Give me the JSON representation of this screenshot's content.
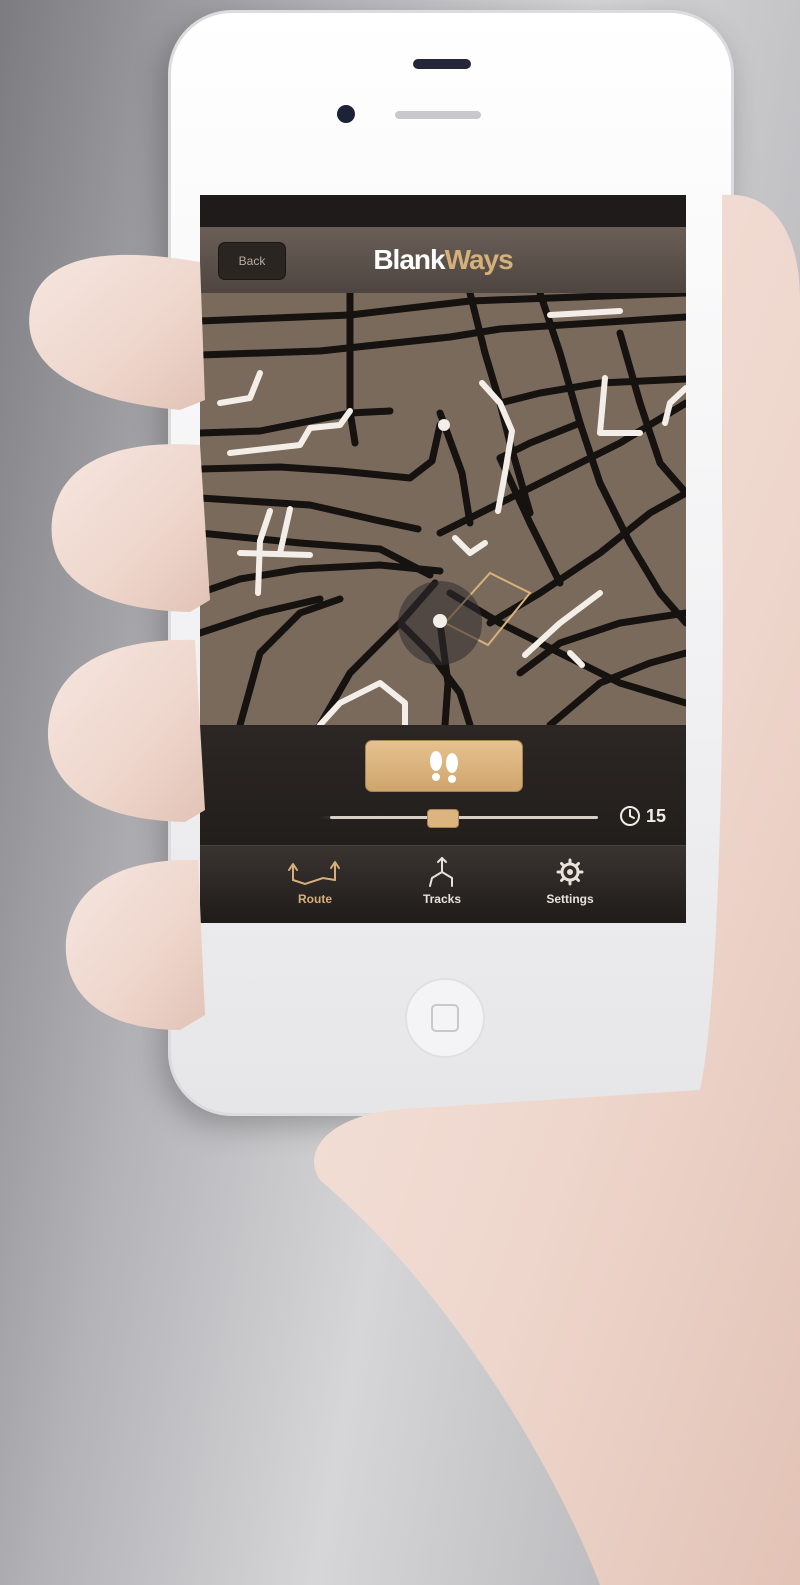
{
  "app": {
    "title_part1": "Blank",
    "title_part2": "Ways",
    "title_color_part2": "#d6b07a"
  },
  "nav": {
    "back_label": "Back"
  },
  "controls": {
    "walk_icon": "footprints-icon",
    "duration_minutes": "15",
    "duration_icon": "clock-icon",
    "slider_level": 0.45
  },
  "tabs": [
    {
      "label": "Route",
      "icon": "route-icon",
      "active": true
    },
    {
      "label": "Tracks",
      "icon": "tracks-icon",
      "active": false
    },
    {
      "label": "Settings",
      "icon": "gear-icon",
      "active": false
    }
  ],
  "colors": {
    "accent": "#d6b07a",
    "map_background": "#7a6a5c",
    "street": "#151210",
    "walked_street": "#f3efe8"
  }
}
